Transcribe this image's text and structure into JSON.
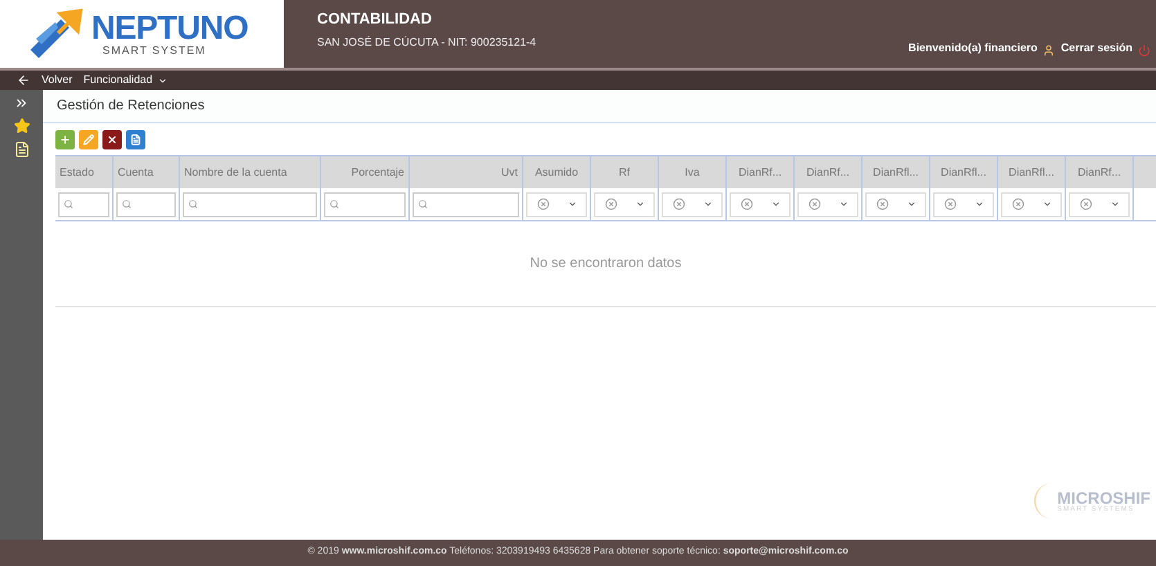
{
  "logo": {
    "name": "NEPTUNO",
    "tagline": "SMART SYSTEM"
  },
  "header": {
    "module": "CONTABILIDAD",
    "company": "SAN JOSÉ DE CÚCUTA - NIT: 900235121-4",
    "welcome": "Bienvenido(a) financiero",
    "logout": "Cerrar sesión"
  },
  "nav": {
    "back": "Volver",
    "menu": "Funcionalidad"
  },
  "page_title": "Gestión de Retenciones",
  "toolbar": [
    {
      "kind": "add"
    },
    {
      "kind": "edit"
    },
    {
      "kind": "delete"
    },
    {
      "kind": "export"
    }
  ],
  "table": {
    "columns": [
      {
        "label": "Estado",
        "kind": "text"
      },
      {
        "label": "Cuenta",
        "kind": "text"
      },
      {
        "label": "Nombre de la cuenta",
        "kind": "text"
      },
      {
        "label": "Porcentaje",
        "kind": "number"
      },
      {
        "label": "Uvt",
        "kind": "number"
      },
      {
        "label": "Asumido",
        "kind": "select"
      },
      {
        "label": "Rf",
        "kind": "select"
      },
      {
        "label": "Iva",
        "kind": "select"
      },
      {
        "label": "DianRf...",
        "kind": "select"
      },
      {
        "label": "DianRf...",
        "kind": "select"
      },
      {
        "label": "DianRfl...",
        "kind": "select"
      },
      {
        "label": "DianRfl...",
        "kind": "select"
      },
      {
        "label": "DianRfl...",
        "kind": "select"
      },
      {
        "label": "DianRf...",
        "kind": "select"
      }
    ],
    "empty_message": "No se encontraron datos"
  },
  "watermark_logo": {
    "name": "MICROSHIF",
    "tagline": "SMART SYSTEMS"
  },
  "footer": "© 2019 **www.microshif.com.co** Teléfonos: 3203919493 6435628 Para obtener soporte técnico: **soporte@microshif.com.co**"
}
